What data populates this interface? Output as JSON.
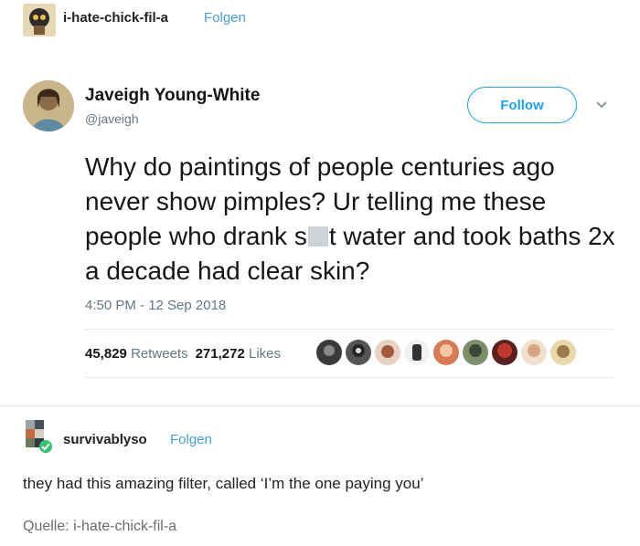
{
  "post": {
    "author": "i-hate-chick-fil-a",
    "follow_label": "Folgen"
  },
  "tweet": {
    "name": "Javeigh Young-White",
    "handle": "@javeigh",
    "follow_label": "Follow",
    "text_before": "Why do paintings of people centuries ago never show pimples? Ur telling me these people who drank s",
    "text_after": "t water and took baths 2x a decade had clear skin?",
    "timestamp": "4:50 PM - 12 Sep 2018",
    "retweets_count": "45,829",
    "retweets_label": "Retweets",
    "likes_count": "271,272",
    "likes_label": "Likes",
    "accent_color": "#1da1f2"
  },
  "reblog": {
    "author": "survivablyso",
    "follow_label": "Folgen",
    "text": "they had this amazing filter, called ‘I’m the one paying you’"
  },
  "source": {
    "text": "Quelle: i-hate-chick-fil-a"
  }
}
